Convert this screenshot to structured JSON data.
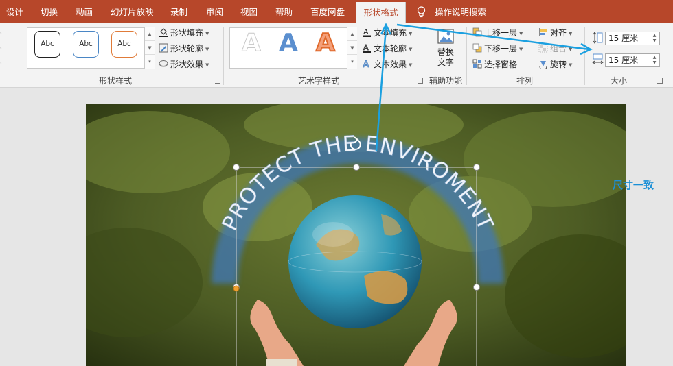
{
  "tabs": [
    "设计",
    "切换",
    "动画",
    "幻灯片放映",
    "录制",
    "审阅",
    "视图",
    "帮助",
    "百度网盘",
    "形状格式"
  ],
  "active_tab": "形状格式",
  "tell_me": "操作说明搜索",
  "ribbon": {
    "shape_styles": {
      "label": "形状样式",
      "presets": [
        "Abc",
        "Abc",
        "Abc"
      ],
      "fill": "形状填充",
      "outline": "形状轮廓",
      "effects": "形状效果"
    },
    "wordart_styles": {
      "label": "艺术字样式",
      "presets": [
        "A",
        "A",
        "A"
      ],
      "text_fill": "文本填充",
      "text_outline": "文本轮廓",
      "text_effects": "文本效果"
    },
    "accessibility": {
      "label": "辅助功能",
      "alt_text_line1": "替换",
      "alt_text_line2": "文字"
    },
    "arrange": {
      "label": "排列",
      "bring_forward": "上移一层",
      "send_backward": "下移一层",
      "selection_pane": "选择窗格",
      "align": "对齐",
      "group": "组合",
      "rotate": "旋转"
    },
    "size": {
      "label": "大小",
      "height": "15 厘米",
      "width": "15 厘米"
    }
  },
  "annotation": "尺寸一致",
  "slide": {
    "arc_text": "PROTECT THE ENVIROMENT"
  },
  "colors": {
    "tab_bar": "#b7472a",
    "ribbon": "#f3f3f3",
    "annotation": "#1b8fd6"
  }
}
